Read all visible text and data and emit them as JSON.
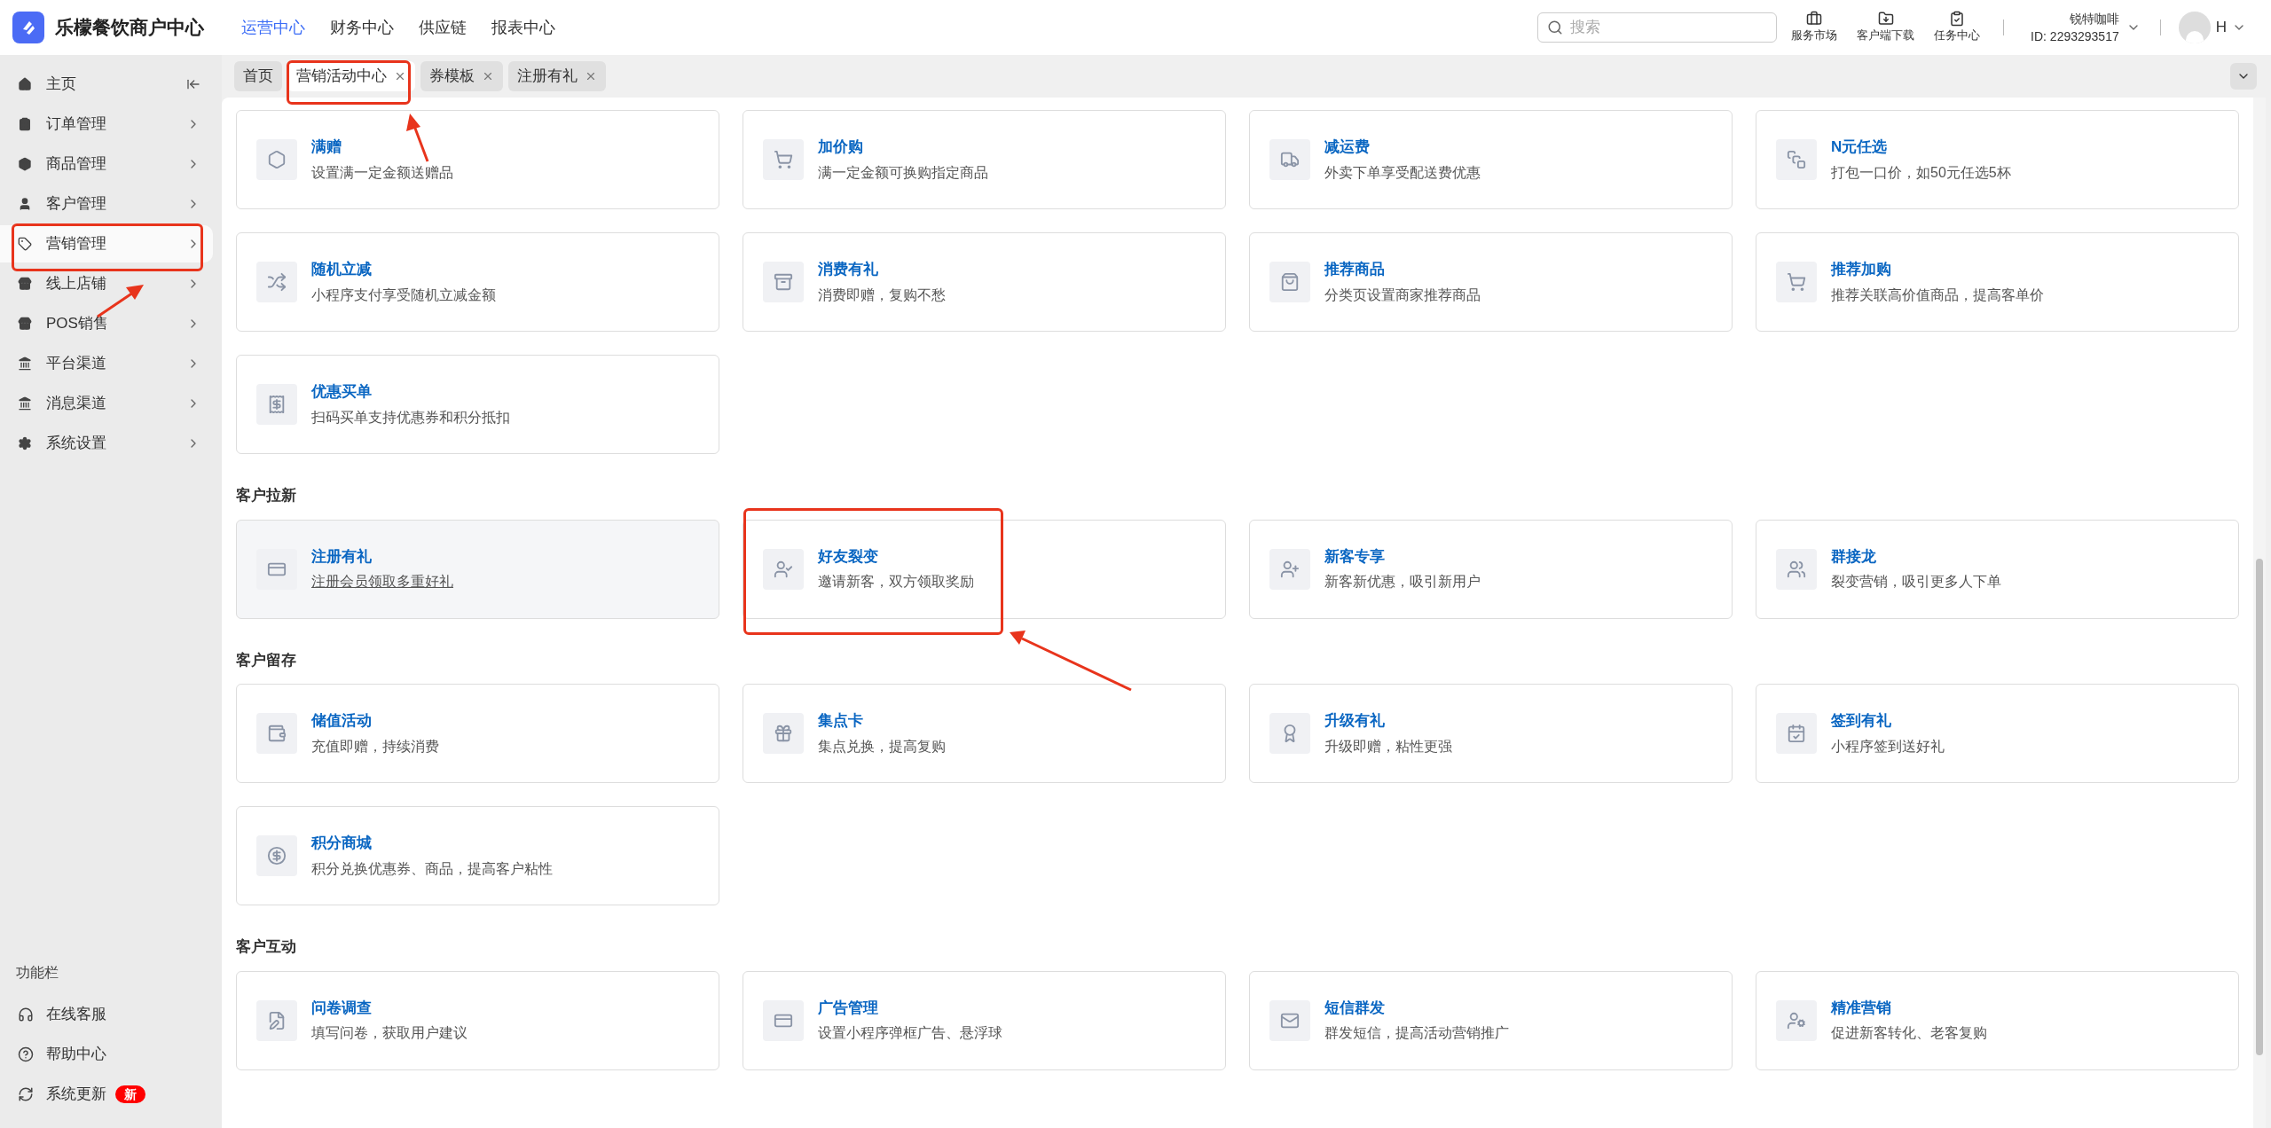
{
  "header": {
    "logo_text": "乐檬餐饮商户中心",
    "nav": [
      {
        "label": "运营中心",
        "selected": true
      },
      {
        "label": "财务中心",
        "selected": false
      },
      {
        "label": "供应链",
        "selected": false
      },
      {
        "label": "报表中心",
        "selected": false
      }
    ],
    "search": {
      "placeholder": "搜索"
    },
    "tools": [
      "服务市场",
      "客户端下载",
      "任务中心"
    ],
    "store": {
      "name": "锐特咖啡",
      "id": "ID: 2293293517"
    },
    "user": "H"
  },
  "sidebar": {
    "items": [
      {
        "label": "主页",
        "selected": false
      },
      {
        "label": "订单管理",
        "selected": false
      },
      {
        "label": "商品管理",
        "selected": false
      },
      {
        "label": "客户管理",
        "selected": false
      },
      {
        "label": "营销管理",
        "selected": true
      },
      {
        "label": "线上店铺",
        "selected": false
      },
      {
        "label": "POS销售",
        "selected": false
      },
      {
        "label": "平台渠道",
        "selected": false
      },
      {
        "label": "消息渠道",
        "selected": false
      },
      {
        "label": "系统设置",
        "selected": false
      }
    ],
    "footer_title": "功能栏",
    "footer_items": [
      {
        "label": "在线客服"
      },
      {
        "label": "帮助中心"
      },
      {
        "label": "系统更新",
        "badge": "新"
      }
    ]
  },
  "tabs": [
    {
      "label": "首页",
      "selected": false,
      "closable": false
    },
    {
      "label": "营销活动中心",
      "selected": true,
      "closable": true
    },
    {
      "label": "券模板",
      "selected": false,
      "closable": true
    },
    {
      "label": "注册有礼",
      "selected": false,
      "closable": true
    }
  ],
  "sections": [
    {
      "cards": [
        {
          "title": "满赠",
          "desc": "设置满一定金额送赠品",
          "highlighted": false
        },
        {
          "title": "加价购",
          "desc": "满一定金额可换购指定商品",
          "highlighted": false
        },
        {
          "title": "减运费",
          "desc": "外卖下单享受配送费优惠",
          "highlighted": false
        },
        {
          "title": "N元任选",
          "desc": "打包一口价，如50元任选5杯",
          "highlighted": false
        },
        {
          "title": "随机立减",
          "desc": "小程序支付享受随机立减金额",
          "highlighted": false
        },
        {
          "title": "消费有礼",
          "desc": "消费即赠，复购不愁",
          "highlighted": false
        },
        {
          "title": "推荐商品",
          "desc": "分类页设置商家推荐商品",
          "highlighted": false
        },
        {
          "title": "推荐加购",
          "desc": "推荐关联高价值商品，提高客单价",
          "highlighted": false
        },
        {
          "title": "优惠买单",
          "desc": "扫码买单支持优惠券和积分抵扣",
          "highlighted": false
        }
      ]
    },
    {
      "title": "客户拉新",
      "cards": [
        {
          "title": "注册有礼",
          "desc": "注册会员领取多重好礼",
          "highlighted": true
        },
        {
          "title": "好友裂变",
          "desc": "邀请新客，双方领取奖励",
          "highlighted": false
        },
        {
          "title": "新客专享",
          "desc": "新客新优惠，吸引新用户",
          "highlighted": false
        },
        {
          "title": "群接龙",
          "desc": "裂变营销，吸引更多人下单",
          "highlighted": false
        }
      ]
    },
    {
      "title": "客户留存",
      "cards": [
        {
          "title": "储值活动",
          "desc": "充值即赠，持续消费",
          "highlighted": false
        },
        {
          "title": "集点卡",
          "desc": "集点兑换，提高复购",
          "highlighted": false
        },
        {
          "title": "升级有礼",
          "desc": "升级即赠，粘性更强",
          "highlighted": false
        },
        {
          "title": "签到有礼",
          "desc": "小程序签到送好礼",
          "highlighted": false
        },
        {
          "title": "积分商城",
          "desc": "积分兑换优惠券、商品，提高客户粘性",
          "highlighted": false
        }
      ]
    },
    {
      "title": "客户互动",
      "cards": [
        {
          "title": "问卷调查",
          "desc": "填写问卷，获取用户建议",
          "highlighted": false
        },
        {
          "title": "广告管理",
          "desc": "设置小程序弹框广告、悬浮球",
          "highlighted": false
        },
        {
          "title": "短信群发",
          "desc": "群发短信，提高活动营销推广",
          "highlighted": false
        },
        {
          "title": "精准营销",
          "desc": "促进新客转化、老客复购",
          "highlighted": false
        }
      ]
    }
  ]
}
